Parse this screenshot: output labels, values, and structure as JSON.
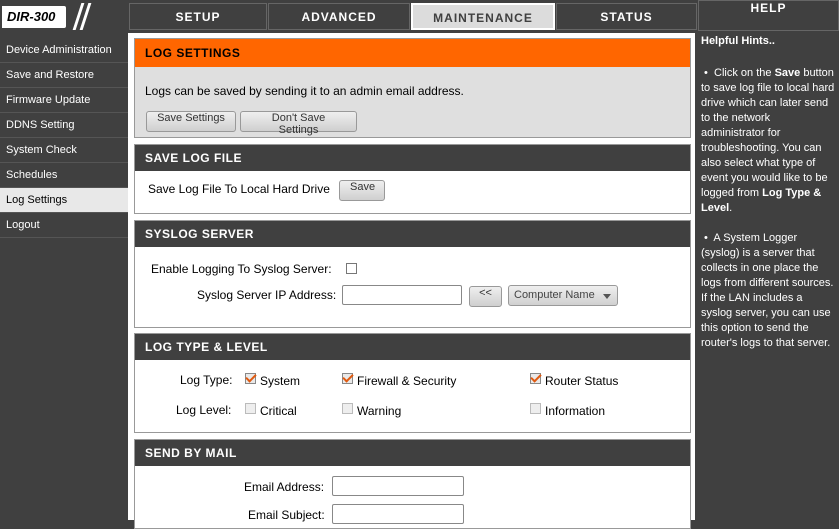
{
  "brand": {
    "model": "DIR-300"
  },
  "tabs": [
    {
      "label": "SETUP",
      "active": false
    },
    {
      "label": "ADVANCED",
      "active": false
    },
    {
      "label": "MAINTENANCE",
      "active": true
    },
    {
      "label": "STATUS",
      "active": false
    }
  ],
  "help": {
    "title": "HELP",
    "heading": "Helpful Hints..",
    "hint1_pre": "Click on the ",
    "hint1_b1": "Save",
    "hint1_mid": " button to save log file to local hard drive which can later send to the network administrator for troubleshooting. You can also select what type of event you would like to be logged from ",
    "hint1_b2": "Log Type & Level",
    "hint1_post": ".",
    "hint2": "A System Logger (syslog) is a server that collects in one place the logs from different sources. If the LAN includes a syslog server, you can use this option to send the router's logs to that server."
  },
  "nav": {
    "items": [
      {
        "label": "Device Administration",
        "active": false
      },
      {
        "label": "Save and Restore",
        "active": false
      },
      {
        "label": "Firmware Update",
        "active": false
      },
      {
        "label": "DDNS Setting",
        "active": false
      },
      {
        "label": "System Check",
        "active": false
      },
      {
        "label": "Schedules",
        "active": false
      },
      {
        "label": "Log Settings",
        "active": true
      },
      {
        "label": "Logout",
        "active": false
      }
    ]
  },
  "log_settings": {
    "title": "LOG SETTINGS",
    "description": "Logs can be saved by sending it to an admin email address.",
    "save_label": "Save Settings",
    "dont_save_label": "Don't Save Settings"
  },
  "save_log_file": {
    "title": "SAVE LOG FILE",
    "label": "Save Log File To Local Hard Drive",
    "save_label": "Save"
  },
  "syslog": {
    "title": "SYSLOG SERVER",
    "enable_label": "Enable Logging To Syslog Server:",
    "enable_checked": false,
    "ip_label": "Syslog Server IP Address:",
    "ip_value": "",
    "copy_button": "<<",
    "computer_select": "Computer Name"
  },
  "log_type_level": {
    "title": "LOG TYPE & LEVEL",
    "type_label": "Log Type:",
    "level_label": "Log Level:",
    "types": [
      {
        "label": "System",
        "checked": true
      },
      {
        "label": "Firewall & Security",
        "checked": true
      },
      {
        "label": "Router Status",
        "checked": true
      }
    ],
    "levels": [
      {
        "label": "Critical",
        "checked": false
      },
      {
        "label": "Warning",
        "checked": false
      },
      {
        "label": "Information",
        "checked": false
      }
    ]
  },
  "send_by_mail": {
    "title": "SEND BY MAIL",
    "email_label": "Email Address:",
    "email_value": "",
    "subject_label": "Email Subject:",
    "subject_value": ""
  },
  "colors": {
    "accent": "#ff6600",
    "dark": "#404040",
    "check": "#e05a10"
  }
}
